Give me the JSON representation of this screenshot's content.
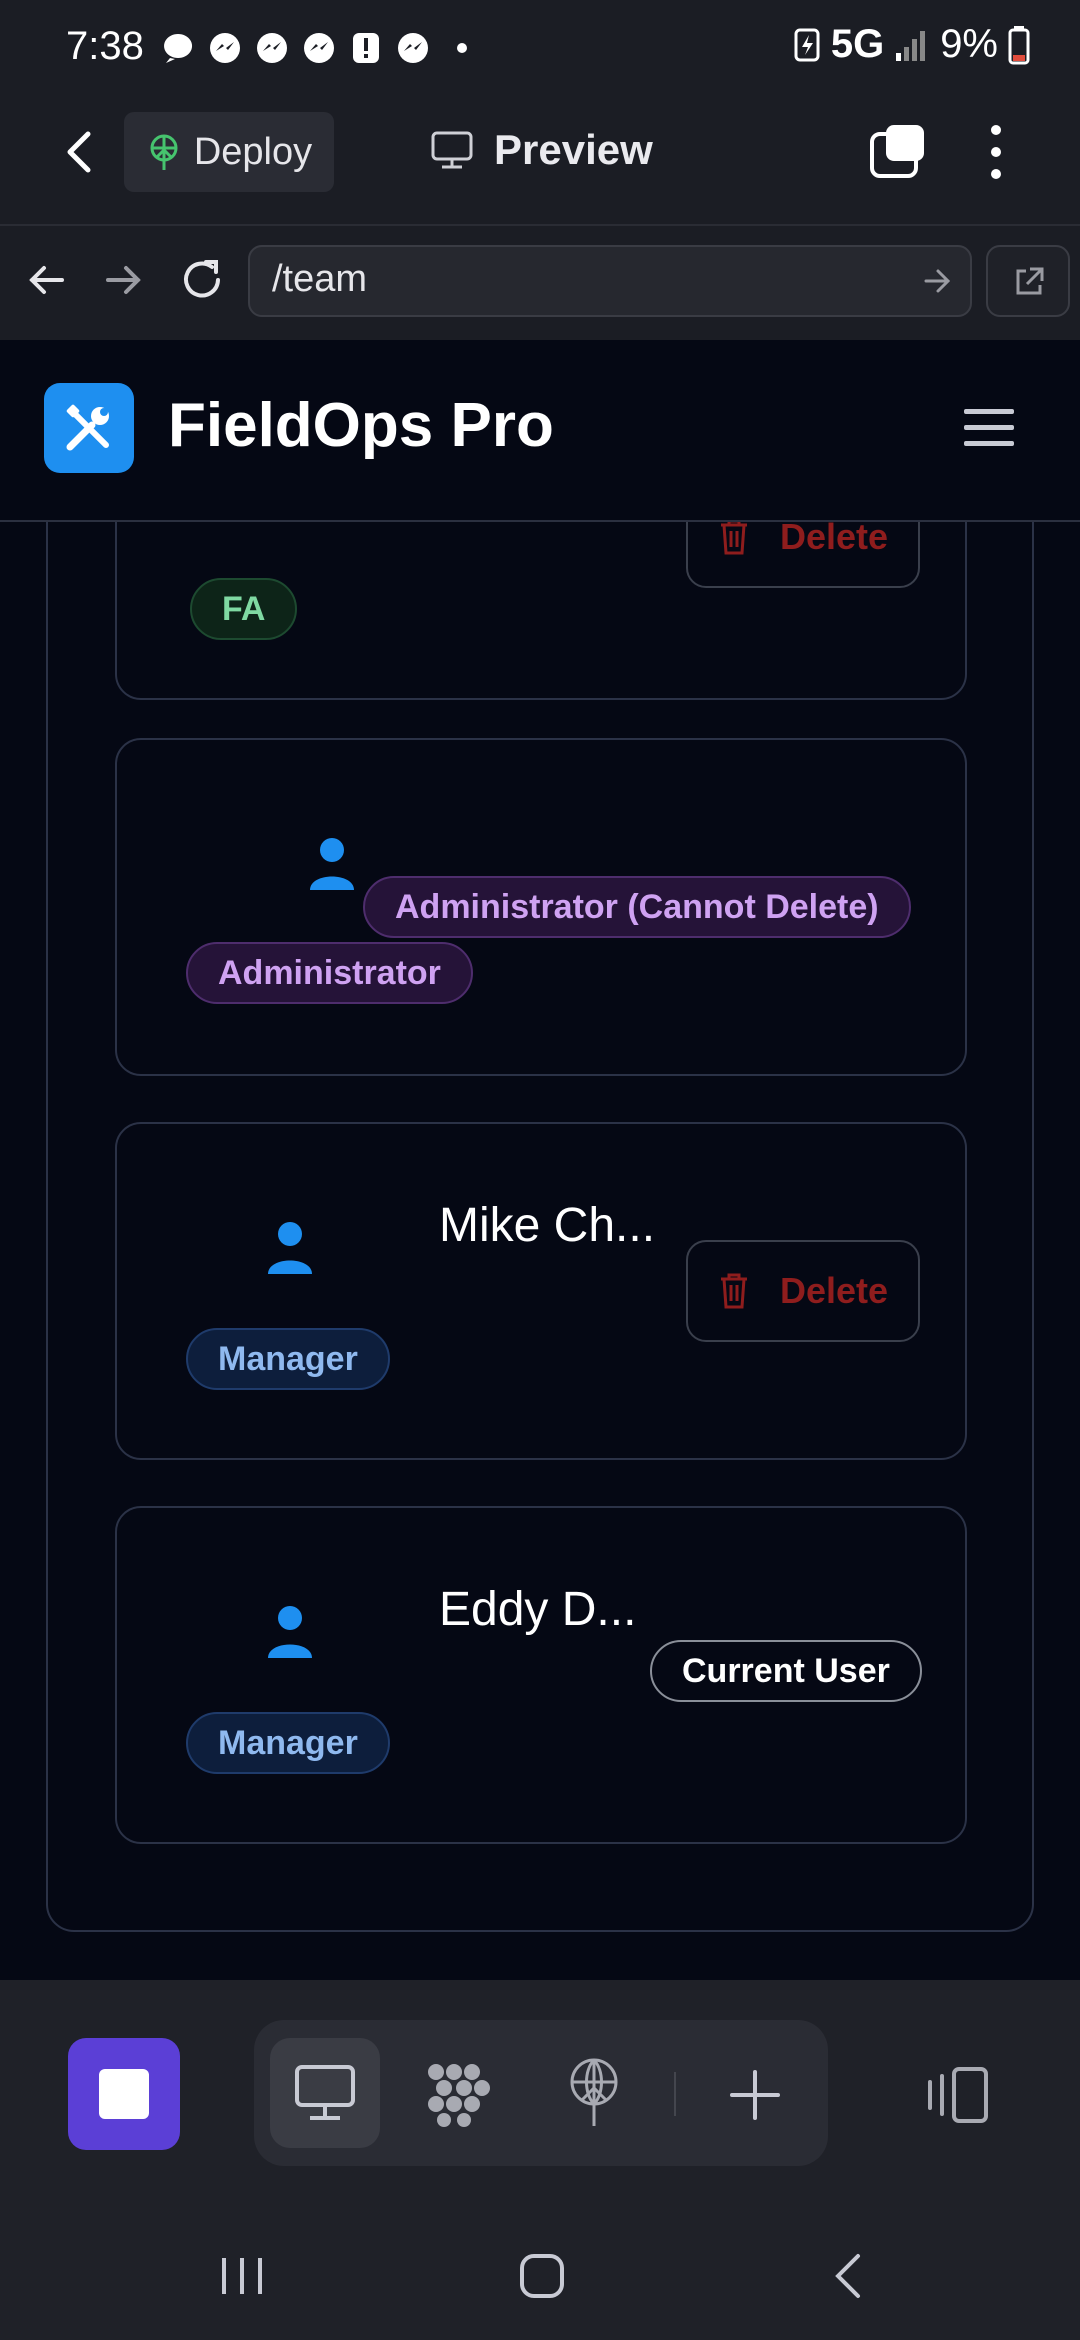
{
  "status_bar": {
    "time": "7:38",
    "network": "5G",
    "battery": "9%",
    "icons": [
      "threads-icon",
      "messenger-icon",
      "messenger-icon",
      "messenger-icon",
      "alert-icon",
      "messenger-icon",
      "dot-icon"
    ]
  },
  "toolbar": {
    "deploy_label": "Deploy",
    "preview_label": "Preview"
  },
  "url_bar": {
    "url": "/team"
  },
  "app": {
    "title": "FieldOps Pro",
    "accent_color": "#1e8ff0"
  },
  "team_cards": [
    {
      "role_badge": "FA",
      "action_label": "Delete"
    },
    {
      "status_badge": "Administrator (Cannot Delete)",
      "role_badge": "Administrator"
    },
    {
      "name": "Mike Ch...",
      "role_badge": "Manager",
      "action_label": "Delete"
    },
    {
      "name": "Eddy D...",
      "status_badge": "Current User",
      "role_badge": "Manager"
    }
  ],
  "dock": {
    "items": [
      "stop-icon",
      "desktop-icon",
      "apps-icon",
      "deploy-icon",
      "add-icon",
      "device-icon"
    ]
  }
}
